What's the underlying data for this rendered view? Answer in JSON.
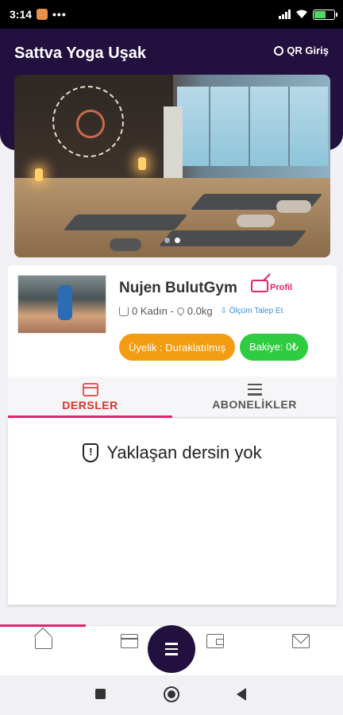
{
  "status_bar": {
    "time": "3:14",
    "dots": "•••"
  },
  "header": {
    "title": "Sattva Yoga Uşak",
    "qr_label": "QR Giriş"
  },
  "hero": {
    "slide_count": 2,
    "active_slide": 2
  },
  "profile": {
    "name": "Nujen BulutGym",
    "profil_label": "Profil",
    "gender": "0 Kadın -",
    "weight": "0.0kg",
    "measure_link": "Ölçüm Talep Et",
    "membership": "Üyelik : Duraklatılmış",
    "balance": "Bakiye: 0₺",
    "colors": {
      "membership": "#f39c12",
      "balance": "#2ecc40",
      "accent": "#e0266d"
    }
  },
  "tabs": [
    {
      "label": "DERSLER",
      "icon": "calendar-icon",
      "active": true
    },
    {
      "label": "ABONELİKLER",
      "icon": "list-icon",
      "active": false
    }
  ],
  "content": {
    "empty_message": "Yaklaşan dersin yok",
    "icon": "shield-alert-icon"
  },
  "bottom_nav": {
    "items": [
      "home-icon",
      "calendar-icon",
      "menu-icon",
      "wallet-icon",
      "mail-icon"
    ],
    "active_index": 0
  },
  "theme": {
    "header_bg": "#22103f"
  }
}
